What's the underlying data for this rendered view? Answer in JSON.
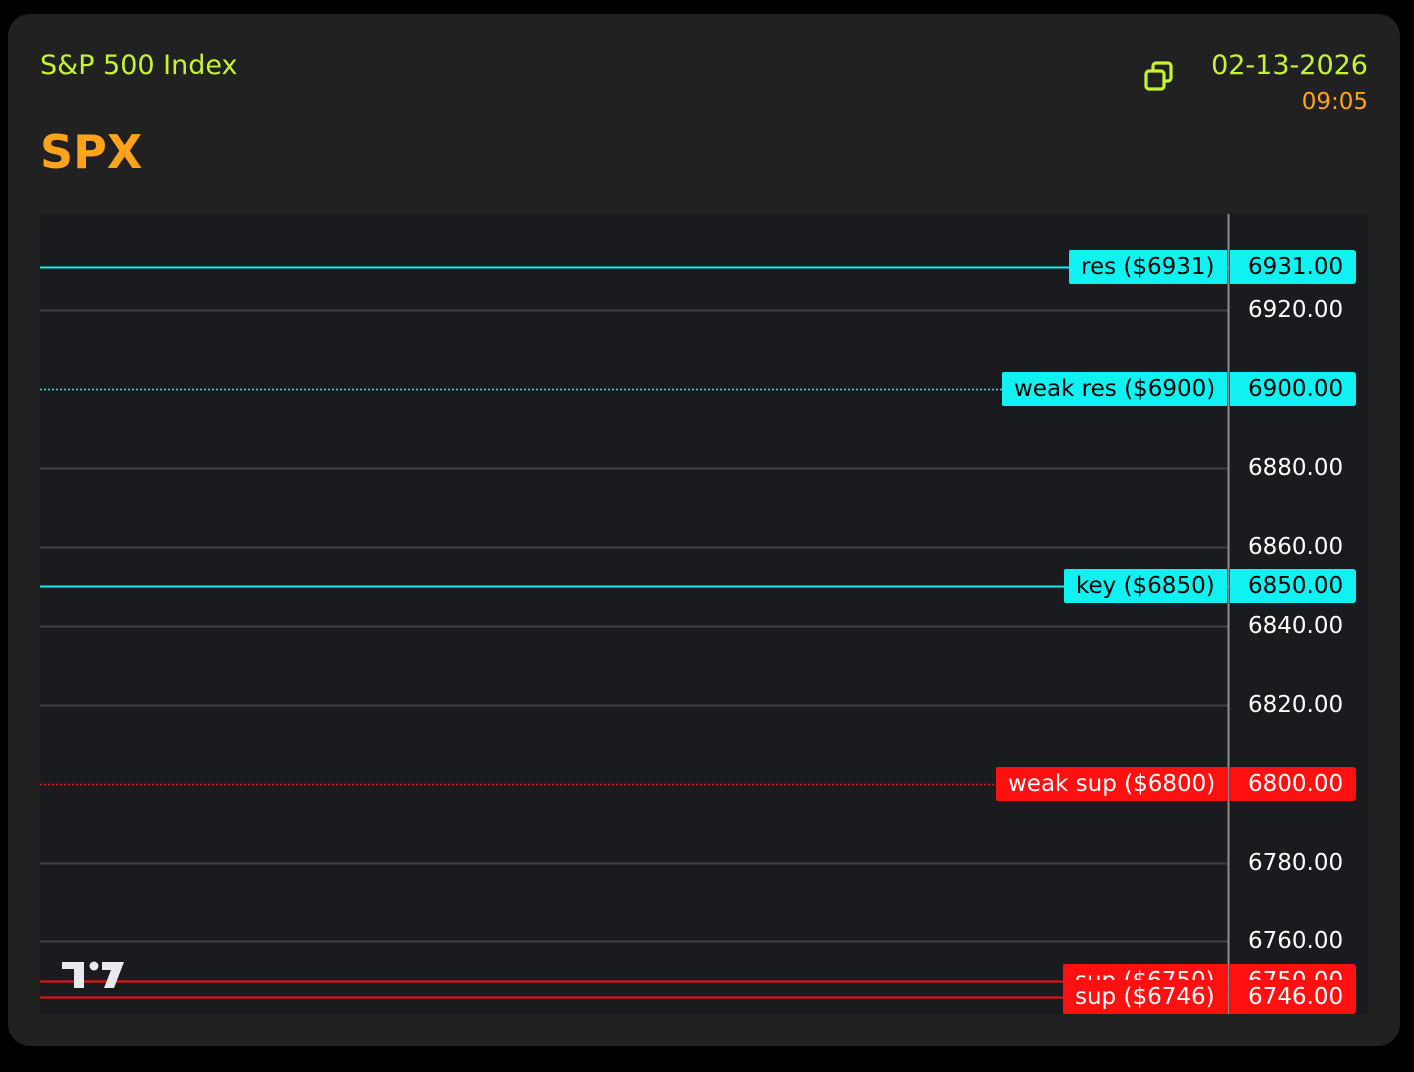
{
  "header": {
    "index_name": "S&P 500 Index",
    "ticker": "SPX",
    "date": "02-13-2026",
    "time": "09:05",
    "copy_icon": "copy-icon"
  },
  "colors": {
    "card_bg": "#212121",
    "chart_bg": "#1a1b1f",
    "index_name": "#c6f432",
    "ticker": "#ffa31a",
    "date": "#c6f432",
    "time": "#ffa31a",
    "resistance": "#10f2f2",
    "support": "#ff1010",
    "grid": "#3f4045",
    "axis_line": "#8a8c92",
    "tick_text": "#ffffff"
  },
  "chart_data": {
    "type": "line",
    "title": "",
    "xlabel": "",
    "ylabel": "",
    "ylim": [
      6741.6,
      6944.4
    ],
    "y_ticks": [
      6760,
      6780,
      6820,
      6840,
      6860,
      6880,
      6920
    ],
    "y_tick_labels": [
      "6760.00",
      "6780.00",
      "6820.00",
      "6840.00",
      "6860.00",
      "6880.00",
      "6920.00"
    ],
    "grid": true,
    "y_axis_position": "right",
    "levels": [
      {
        "name": "res ($6931)",
        "value": 6931,
        "price_label": "6931.00",
        "kind": "resistance",
        "style": "solid"
      },
      {
        "name": "weak res ($6900)",
        "value": 6900,
        "price_label": "6900.00",
        "kind": "resistance",
        "style": "dotted"
      },
      {
        "name": "key ($6850)",
        "value": 6850,
        "price_label": "6850.00",
        "kind": "resistance",
        "style": "solid"
      },
      {
        "name": "weak sup ($6800)",
        "value": 6800,
        "price_label": "6800.00",
        "kind": "support",
        "style": "dotted"
      },
      {
        "name": "sup ($6750)",
        "value": 6750,
        "price_label": "6750.00",
        "kind": "support",
        "style": "solid"
      },
      {
        "name": "sup ($6746)",
        "value": 6746,
        "price_label": "6746.00",
        "kind": "support",
        "style": "solid"
      }
    ]
  },
  "branding": {
    "logo_icon": "tradingview-logo-icon"
  }
}
